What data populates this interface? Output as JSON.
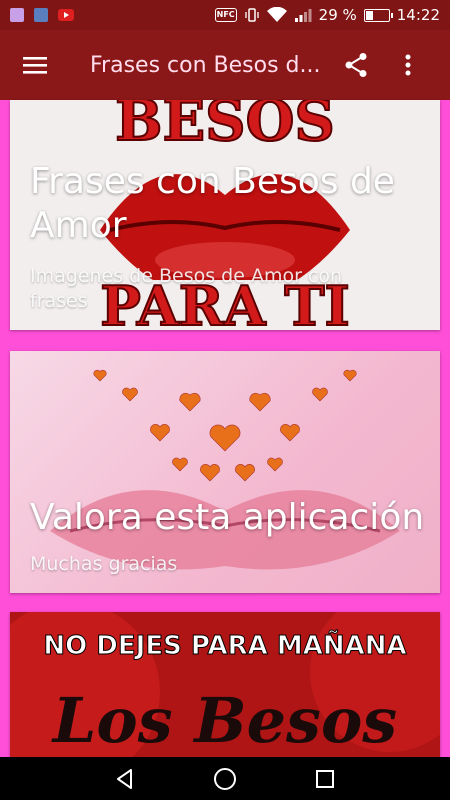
{
  "status_bar": {
    "notification_icons": [
      "gallery-icon",
      "maps-icon",
      "youtube-icon"
    ],
    "nfc_label": "NFC",
    "battery_percent": "29 %",
    "battery_level": 0.29,
    "time": "14:22"
  },
  "app_bar": {
    "title": "Frases con Besos d...",
    "menu_icon": "hamburger-menu-icon",
    "share_icon": "share-icon",
    "more_icon": "more-vert-icon"
  },
  "cards": [
    {
      "title": "Frases con Besos de Amor",
      "subtitle": "Imagenes de Besos de Amor con frases",
      "art_text_top": "BESOS",
      "art_text_bottom": "PARA TI"
    },
    {
      "title": "Valora esta aplicación",
      "subtitle": "Muchas gracias"
    },
    {
      "art_text_top": "NO DEJES PARA MAÑANA",
      "art_text_bottom": "Los Besos"
    }
  ],
  "colors": {
    "status_bar": "#7f1515",
    "app_bar": "#8b1818",
    "background": "#ff4fd8",
    "nav_bar": "#000000"
  },
  "nav_bar": {
    "back_icon": "back-triangle-icon",
    "home_icon": "home-circle-icon",
    "recents_icon": "recents-square-icon"
  }
}
